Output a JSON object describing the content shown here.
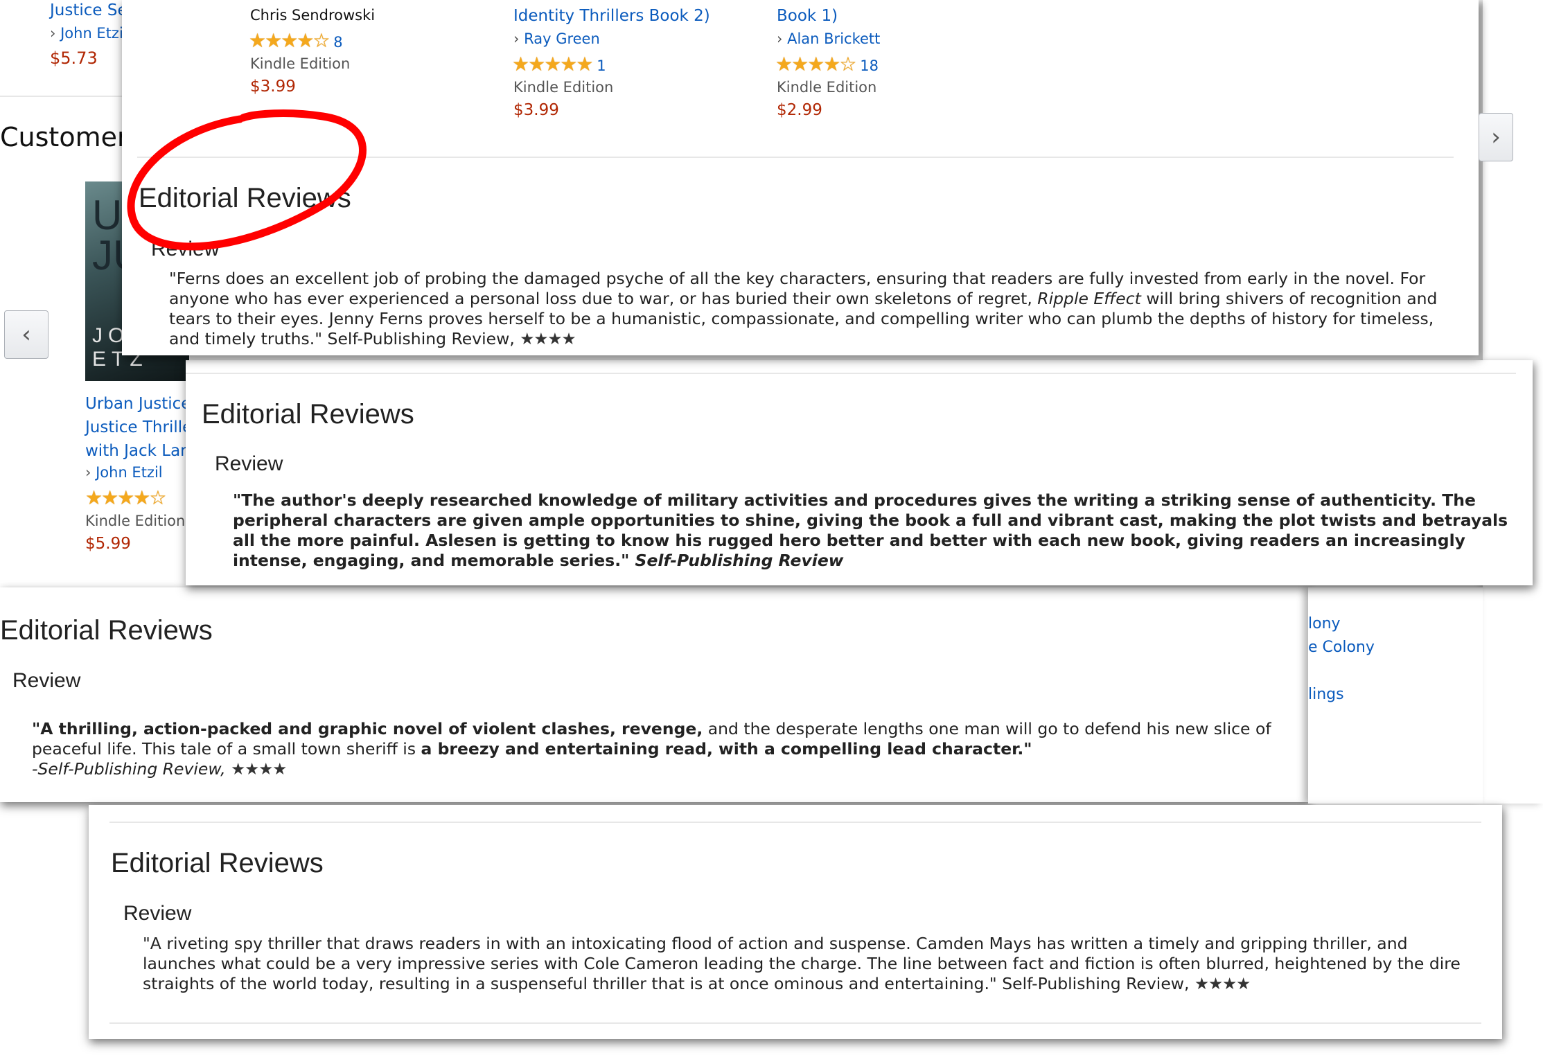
{
  "background_page": {
    "top_left_item": {
      "title_fragment": "Justice Se",
      "author": "John Etzi",
      "price": "$5.73"
    },
    "section_heading": "Customers",
    "prev_button_icon": "chevron-left-icon",
    "next_button_icon": "chevron-right-icon",
    "book": {
      "cover_text_top": "U\nJU",
      "cover_author": "JOHN ETZ",
      "title_lines": [
        "Urban Justice",
        "Justice Thrille",
        "with Jack Lam"
      ],
      "author": "John Etzil",
      "rating": 4.5,
      "format": "Kindle Edition",
      "price": "$5.99"
    },
    "right_links": [
      "lony",
      "e Colony",
      "lings"
    ]
  },
  "card1": {
    "products": [
      {
        "author": "Chris Sendrowski",
        "rating": 4.5,
        "review_count": "8",
        "format": "Kindle Edition",
        "price": "$3.99"
      },
      {
        "title_tail": "Identity Thrillers Book 2)",
        "author": "Ray Green",
        "rating": 5,
        "review_count": "1",
        "format": "Kindle Edition",
        "price": "$3.99"
      },
      {
        "title_tail": "Book 1)",
        "author": "Alan Brickett",
        "rating": 4.5,
        "review_count": "18",
        "format": "Kindle Edition",
        "price": "$2.99"
      }
    ],
    "heading": "Editorial Reviews",
    "subheading": "Review",
    "body_before_italic": "\"Ferns does an excellent job of probing the damaged psyche of all the key characters, ensuring that readers are fully invested from early in the novel. For anyone who has ever experienced a personal loss due to war, or has buried their own skeletons of regret, ",
    "body_italic": "Ripple Effect",
    "body_after_italic": " will bring shivers of recognition and tears to their eyes. Jenny Ferns proves herself to be a humanistic, compassionate, and compelling writer who can plumb the depths of history for timeless, and timely truths.\" Self-Publishing Review, ",
    "stars": "★★★★",
    "annotation_color": "#ff0000"
  },
  "card2": {
    "heading": "Editorial Reviews",
    "subheading": "Review",
    "body_bold": "\"The author's deeply researched knowledge of military activities and procedures gives the writing a striking sense of authenticity. The peripheral characters are given ample opportunities to shine, giving the book a full and vibrant cast, making the plot twists and betrayals all the more painful. Aslesen is getting to know his rugged hero better and better with each new book, giving readers an increasingly intense, engaging, and memorable series.\" ",
    "source_bold_italic": "Self-Publishing Review"
  },
  "card3": {
    "heading": "Editorial Reviews",
    "subheading": "Review",
    "bold_1": "\"A thrilling, action-packed and graphic novel of violent clashes, revenge,",
    "normal_1": " and the desperate lengths one man will go to defend his new slice of peaceful life. This tale of a small town sheriff is ",
    "bold_2": "a breezy and entertaining read, with a compelling lead character.\"",
    "source_italic": "-Self-Publishing Review,",
    "stars": "★★★★"
  },
  "card4": {
    "heading": "Editorial Reviews",
    "subheading": "Review",
    "body": "\"A riveting spy thriller that draws readers in with an intoxicating flood of action and suspense. Camden Mays has written a timely and gripping thriller, and launches what could be a very impressive series with Cole Cameron leading the charge. The line between fact and fiction is often blurred, heightened by the dire straights of the world today, resulting in a suspenseful thriller that is at once ominous and entertaining.\" Self-Publishing Review, ",
    "stars": "★★★★"
  },
  "colors": {
    "link": "#0b5bbd",
    "price": "#b12704",
    "star": "#f4a81d",
    "annotation": "#ff0000"
  }
}
